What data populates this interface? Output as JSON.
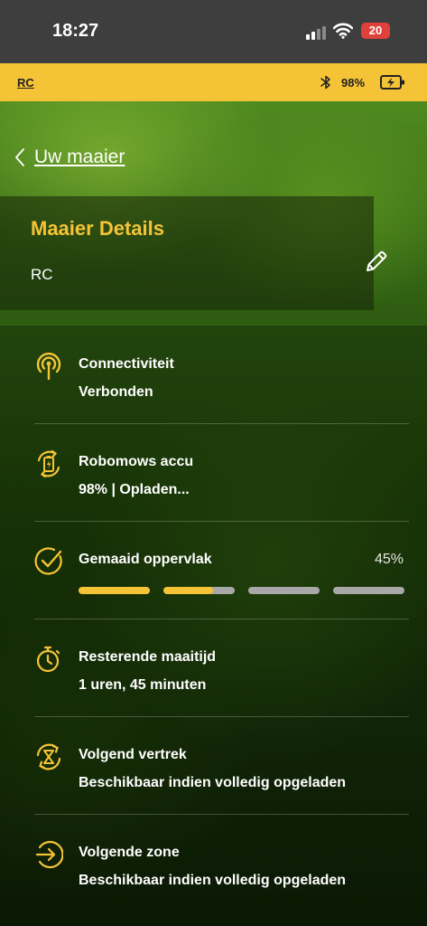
{
  "status_bar": {
    "time": "18:27",
    "battery": "20"
  },
  "app_bar": {
    "mower_short_name": "RC",
    "battery_percent": "98%"
  },
  "nav": {
    "back_label": "Uw maaier"
  },
  "details": {
    "title": "Maaier Details",
    "mower_name": "RC"
  },
  "rows": [
    {
      "title": "Connectiviteit",
      "value": "Verbonden",
      "icon": "connectivity-icon"
    },
    {
      "title": "Robomows accu",
      "value": "98% | Opladen...",
      "icon": "battery-charging-icon"
    },
    {
      "title": "Gemaaid oppervlak",
      "percent": "45%",
      "icon": "check-circle-icon",
      "progress_segments": [
        1,
        0.7,
        0,
        0
      ]
    },
    {
      "title": "Resterende maaitijd",
      "value": "1 uren, 45 minuten",
      "icon": "stopwatch-icon"
    },
    {
      "title": "Volgend vertrek",
      "value": "Beschikbaar indien volledig opgeladen",
      "icon": "hourglass-cycle-icon"
    },
    {
      "title": "Volgende zone",
      "value": "Beschikbaar indien volledig opgeladen",
      "icon": "arrow-circle-icon"
    }
  ],
  "colors": {
    "accent": "#f5c436",
    "status_bar_bg": "#3e3e3e",
    "os_battery_red": "#e0403a",
    "progress_track": "#a8a8a8"
  }
}
